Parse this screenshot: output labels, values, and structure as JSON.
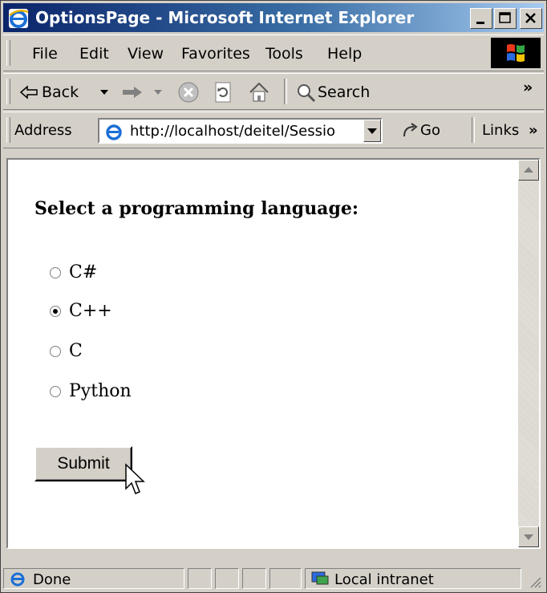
{
  "window": {
    "title": "OptionsPage - Microsoft Internet Explorer"
  },
  "menu": {
    "items": [
      "File",
      "Edit",
      "View",
      "Favorites",
      "Tools",
      "Help"
    ]
  },
  "toolbar": {
    "back_label": "Back",
    "search_label": "Search"
  },
  "address": {
    "label": "Address",
    "url": "http://localhost/deitel/Sessio",
    "go_label": "Go",
    "links_label": "Links"
  },
  "page": {
    "heading": "Select a programming language:",
    "options": [
      {
        "label": "C#",
        "selected": false
      },
      {
        "label": "C++",
        "selected": true
      },
      {
        "label": "C",
        "selected": false
      },
      {
        "label": "Python",
        "selected": false
      }
    ],
    "submit_label": "Submit"
  },
  "status": {
    "text": "Done",
    "zone": "Local intranet"
  },
  "icons": [
    "ie-logo-icon",
    "minimize-icon",
    "maximize-icon",
    "close-icon",
    "windows-logo-icon",
    "back-arrow-icon",
    "forward-arrow-icon",
    "stop-icon",
    "refresh-icon",
    "home-icon",
    "search-icon",
    "go-arrow-icon",
    "mouse-cursor-icon"
  ]
}
